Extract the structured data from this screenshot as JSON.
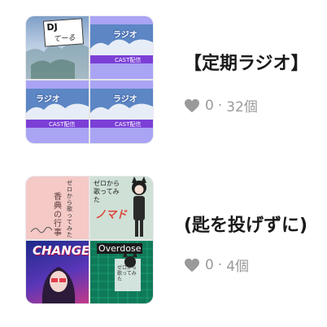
{
  "playlists": [
    {
      "title": "【定期ラジオ】",
      "likes": "0",
      "separator": "·",
      "count": "32個",
      "tiles": [
        {
          "label": "DJ",
          "sub": "てーる",
          "kind": "sky-clouds"
        },
        {
          "label": "ラジオ",
          "sub": "CAST配信",
          "kind": "clouds-banner"
        },
        {
          "label": "ラジオ",
          "sub": "CAST配信",
          "kind": "clouds-banner"
        },
        {
          "label": "ラジオ",
          "sub": "CAST配信",
          "kind": "clouds-banner"
        }
      ]
    },
    {
      "title": "(匙を投げずに)",
      "likes": "0",
      "separator": "·",
      "count": "4個",
      "tiles": [
        {
          "label": "ゼロから歌ってみた",
          "sub": "香典の行事",
          "kind": "pink-text"
        },
        {
          "label": "ゼロから歌ってみた",
          "sub": "ノマド",
          "kind": "catgirl-green"
        },
        {
          "label": "CHANGE",
          "sub": "",
          "kind": "change"
        },
        {
          "label": "Overdose",
          "sub": "ゼロから歌ってみた",
          "kind": "overdose"
        }
      ]
    }
  ],
  "colors": {
    "lavender": "#a9a4f4",
    "heart": "#9a9a9a",
    "text": "#1a1a1a",
    "meta": "#9a9a9a"
  }
}
